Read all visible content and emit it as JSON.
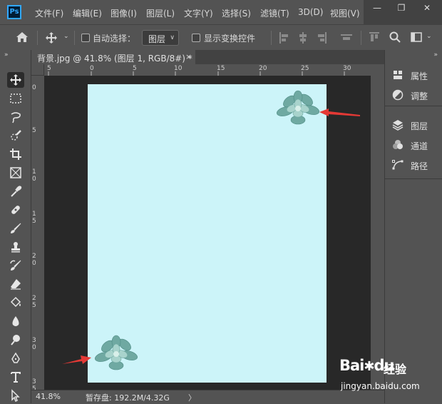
{
  "app": {
    "logo": "Ps"
  },
  "menu": [
    "文件(F)",
    "编辑(E)",
    "图像(I)",
    "图层(L)",
    "文字(Y)",
    "选择(S)",
    "滤镜(T)",
    "3D(D)",
    "视图(V)"
  ],
  "window_buttons": {
    "minimize": "—",
    "restore": "❐",
    "close": "✕"
  },
  "options": {
    "auto_select_label": "自动选择：",
    "layer_select_value": "图层",
    "show_transform_label": "显示变换控件",
    "auto_select_checked": false,
    "show_transform_checked": false
  },
  "document": {
    "tab_title": "背景.jpg @ 41.8% (图层 1, RGB/8#) *",
    "close_glyph": "×",
    "background_color": "#ccf4f9"
  },
  "rulers": {
    "top": [
      "5",
      "0",
      "5",
      "10",
      "15",
      "20",
      "25",
      "30"
    ],
    "left": [
      "0",
      "5",
      "1\n0",
      "1\n5",
      "2\n0",
      "2\n5",
      "3\n0",
      "3\n5"
    ]
  },
  "statusbar": {
    "zoom": "41.8%",
    "scratch": "暂存盘: 192.2M/4.32G",
    "more": "〉"
  },
  "panels": {
    "group1": [
      {
        "label": "属性",
        "icon": "properties-icon"
      },
      {
        "label": "调整",
        "icon": "adjustments-icon"
      }
    ],
    "group2": [
      {
        "label": "图层",
        "icon": "layers-icon"
      },
      {
        "label": "通道",
        "icon": "channels-icon"
      },
      {
        "label": "路径",
        "icon": "paths-icon"
      }
    ]
  },
  "tools": [
    "move-tool",
    "marquee-tool",
    "lasso-tool",
    "quick-select-tool",
    "crop-tool",
    "frame-tool",
    "eyedropper-tool",
    "healing-tool",
    "brush-tool",
    "stamp-tool",
    "history-brush-tool",
    "eraser-tool",
    "fill-tool",
    "blur-tool",
    "dodge-tool",
    "pen-tool",
    "type-tool",
    "path-select-tool"
  ],
  "collapse_glyph": "»",
  "watermark": {
    "brand": "Bai",
    "paw": "du",
    "sub": "经验",
    "url": "jingyan.baidu.com"
  },
  "colors": {
    "accent": "#31a8ff",
    "arrow": "#e53935",
    "plant": "#7fb8b0"
  }
}
